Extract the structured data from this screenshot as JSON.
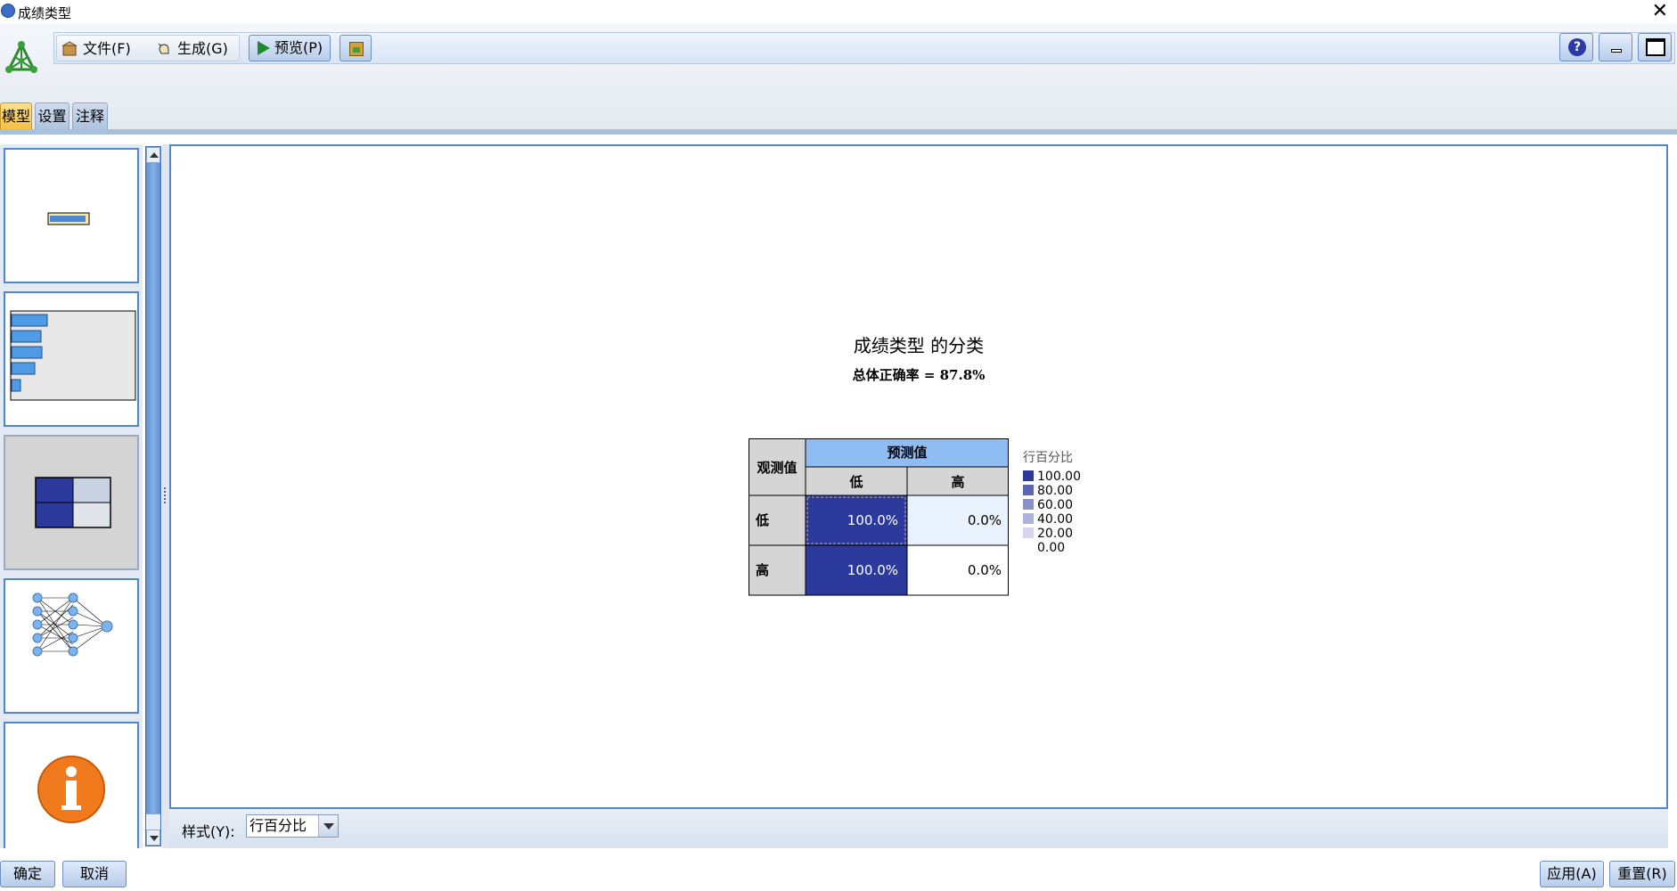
{
  "window": {
    "title": "成绩类型",
    "close_glyph": "✕"
  },
  "toolbar": {
    "menu_file": "文件(F)",
    "menu_generate": "生成(G)",
    "preview": "预览(P)"
  },
  "tabs": [
    {
      "label": "模型",
      "active": true
    },
    {
      "label": "设置",
      "active": false
    },
    {
      "label": "注释",
      "active": false
    }
  ],
  "thumbnails": [
    {
      "name": "predictor-importance-bar"
    },
    {
      "name": "predictor-importance-chart"
    },
    {
      "name": "classification-matrix",
      "selected": true
    },
    {
      "name": "network-diagram"
    },
    {
      "name": "model-summary-info"
    }
  ],
  "chart_data": {
    "type": "table",
    "title": "成绩类型 的分类",
    "subtitle": "总体正确率 = 87.8%",
    "row_header": "观测值",
    "col_header": "预测值",
    "columns": [
      "低",
      "高"
    ],
    "rows": [
      {
        "label": "低",
        "values": [
          100.0,
          0.0
        ],
        "display": [
          "100.0%",
          "0.0%"
        ]
      },
      {
        "label": "高",
        "values": [
          100.0,
          0.0
        ],
        "display": [
          "100.0%",
          "0.0%"
        ]
      }
    ],
    "legend": {
      "title": "行百分比",
      "entries": [
        {
          "label": "100.00",
          "color": "#2b3a9c"
        },
        {
          "label": "80.00",
          "color": "#5a66b4"
        },
        {
          "label": "60.00",
          "color": "#8890c8"
        },
        {
          "label": "40.00",
          "color": "#adb2d9"
        },
        {
          "label": "20.00",
          "color": "#d3d6ec"
        },
        {
          "label": "0.00",
          "color": "#ffffff"
        }
      ]
    },
    "colors": {
      "header": "#8fbcf3",
      "subheader": "#d5d5d5",
      "high": "#2b3a9c",
      "low_light": "#eaf3fd",
      "low_white": "#ffffff"
    }
  },
  "style_bar": {
    "label": "样式(Y):",
    "value": "行百分比"
  },
  "footer": {
    "ok": "确定",
    "cancel": "取消",
    "apply": "应用(A)",
    "reset": "重置(R)"
  }
}
